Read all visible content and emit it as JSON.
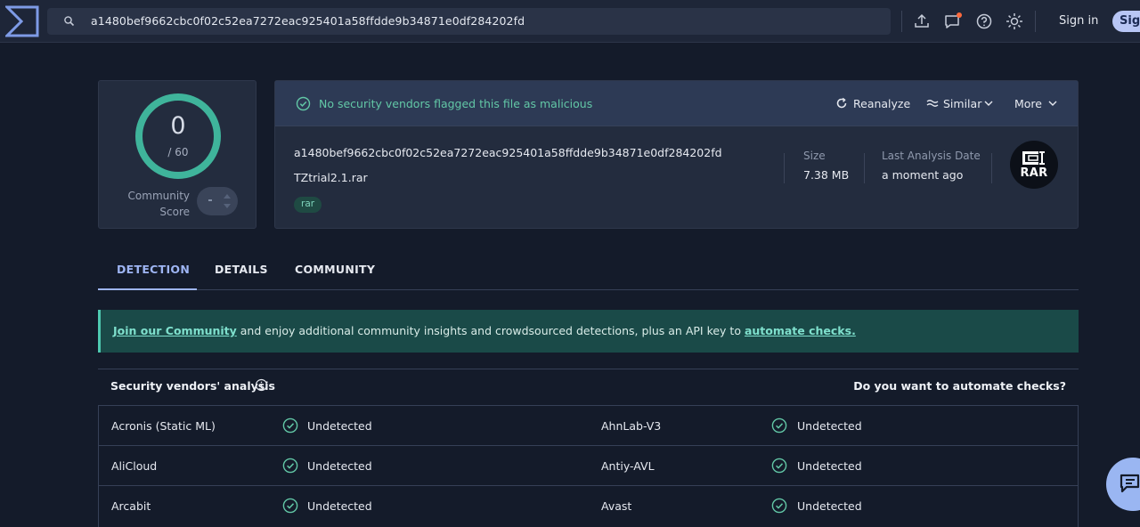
{
  "colors": {
    "accent": "#9eb5f3",
    "success": "#62c7a6",
    "banner_bg": "#1a4a48"
  },
  "search": {
    "value": "a1480bef9662cbc0f02c52ea7272eac925401a58ffdde9b34871e0df284202fd"
  },
  "header": {
    "icons": [
      "upload-icon",
      "notification-icon",
      "help-icon",
      "theme-icon"
    ],
    "sign_in": "Sign in",
    "sign_up": "Sign up"
  },
  "score": {
    "detections": "0",
    "total": "/ 60",
    "community_label_1": "Community",
    "community_label_2": "Score"
  },
  "summary": {
    "status": "No security vendors flagged this file as malicious",
    "actions": {
      "reanalyze": "Reanalyze",
      "similar": "Similar",
      "more": "More"
    },
    "hash": "a1480bef9662cbc0f02c52ea7272eac925401a58ffdde9b34871e0df284202fd",
    "file_name": "TZtrial2.1.rar",
    "tag": "rar",
    "size_label": "Size",
    "size_value": "7.38 MB",
    "date_label": "Last Analysis Date",
    "date_value": "a moment ago",
    "file_type": "RAR"
  },
  "tabs": [
    {
      "label": "DETECTION",
      "active": true
    },
    {
      "label": "DETAILS",
      "active": false
    },
    {
      "label": "COMMUNITY",
      "active": false
    }
  ],
  "banner": {
    "link1": "Join our Community",
    "middle": " and enjoy additional community insights and crowdsourced detections, plus an API key to ",
    "link2": "automate checks."
  },
  "vendors": {
    "title": "Security vendors' analysis",
    "right_label": "Do you want to automate checks?",
    "rows": [
      {
        "left_name": "Acronis (Static ML)",
        "left_result": "Undetected",
        "right_name": "AhnLab-V3",
        "right_result": "Undetected"
      },
      {
        "left_name": "AliCloud",
        "left_result": "Undetected",
        "right_name": "Antiy-AVL",
        "right_result": "Undetected"
      },
      {
        "left_name": "Arcabit",
        "left_result": "Undetected",
        "right_name": "Avast",
        "right_result": "Undetected"
      }
    ]
  }
}
